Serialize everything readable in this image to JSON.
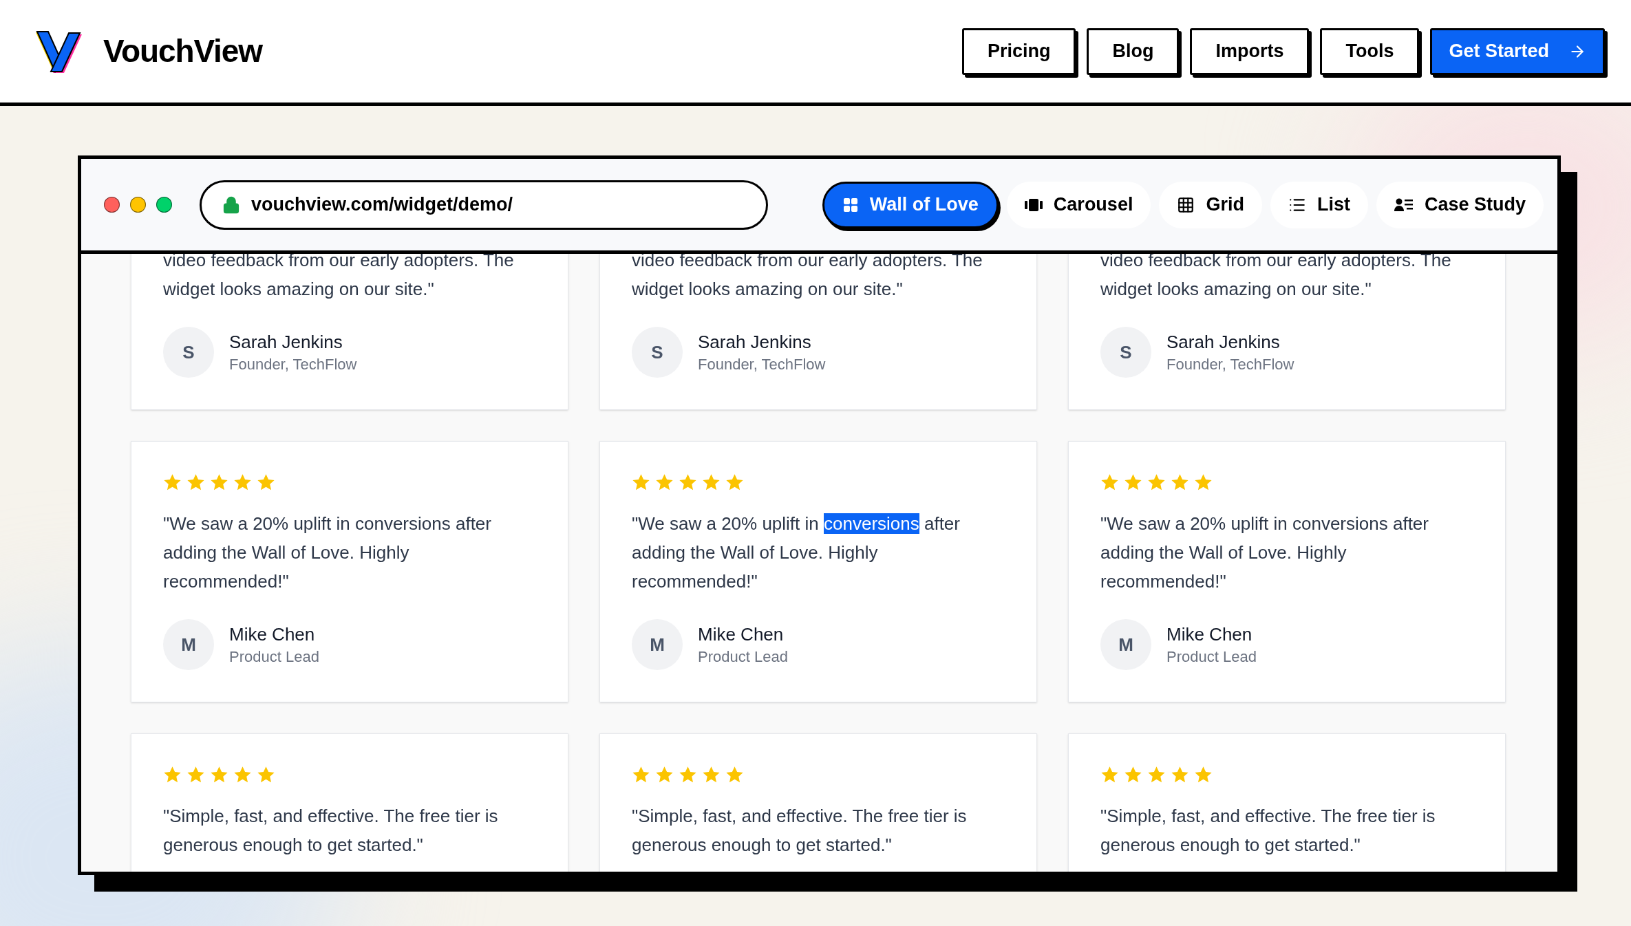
{
  "header": {
    "logo_text": "VouchView",
    "nav": [
      {
        "label": "Pricing",
        "kind": "outline"
      },
      {
        "label": "Blog",
        "kind": "outline"
      },
      {
        "label": "Imports",
        "kind": "outline"
      },
      {
        "label": "Tools",
        "kind": "outline"
      },
      {
        "label": "Get Started",
        "kind": "primary"
      }
    ]
  },
  "browser": {
    "url": "vouchview.com/widget/demo/",
    "view_tabs": [
      {
        "label": "Wall of Love",
        "selected": true
      },
      {
        "label": "Carousel",
        "selected": false
      },
      {
        "label": "Grid",
        "selected": false
      },
      {
        "label": "List",
        "selected": false
      },
      {
        "label": "Case Study",
        "selected": false
      }
    ]
  },
  "cards": [
    {
      "quote": [
        {
          "text": "video feedback from our early adopters. The widget looks amazing on our site.\"",
          "selected": false
        }
      ],
      "author": {
        "initial": "S",
        "name": "Sarah Jenkins",
        "role": "Founder, TechFlow"
      }
    },
    {
      "quote": [
        {
          "text": "video feedback from our early adopters. The widget looks amazing on our site.\"",
          "selected": false
        }
      ],
      "author": {
        "initial": "S",
        "name": "Sarah Jenkins",
        "role": "Founder, TechFlow"
      }
    },
    {
      "quote": [
        {
          "text": "video feedback from our early adopters. The widget looks amazing on our site.\"",
          "selected": false
        }
      ],
      "author": {
        "initial": "S",
        "name": "Sarah Jenkins",
        "role": "Founder, TechFlow"
      }
    },
    {
      "stars": 5,
      "quote": [
        {
          "text": "\"We saw a 20% uplift in conversions after adding the Wall of Love. Highly recommended!\"",
          "selected": false
        }
      ],
      "author": {
        "initial": "M",
        "name": "Mike Chen",
        "role": "Product Lead"
      }
    },
    {
      "stars": 5,
      "quote": [
        {
          "text": "\"We saw a 20% uplift in ",
          "selected": false
        },
        {
          "text": "conversions",
          "selected": true
        },
        {
          "text": " after adding the Wall of Love. Highly recommended!\"",
          "selected": false
        }
      ],
      "author": {
        "initial": "M",
        "name": "Mike Chen",
        "role": "Product Lead"
      }
    },
    {
      "stars": 5,
      "quote": [
        {
          "text": "\"We saw a 20% uplift in conversions after adding the Wall of Love. Highly recommended!\"",
          "selected": false
        }
      ],
      "author": {
        "initial": "M",
        "name": "Mike Chen",
        "role": "Product Lead"
      }
    },
    {
      "stars": 5,
      "quote": [
        {
          "text": "\"Simple, fast, and effective. The free tier is generous enough to get started.\"",
          "selected": false
        }
      ]
    },
    {
      "stars": 5,
      "quote": [
        {
          "text": "\"Simple, fast, and effective. The free tier is generous enough to get started.\"",
          "selected": false
        }
      ]
    },
    {
      "stars": 5,
      "quote": [
        {
          "text": "\"Simple, fast, and effective. The free tier is generous enough to get started.\"",
          "selected": false
        }
      ]
    }
  ]
}
